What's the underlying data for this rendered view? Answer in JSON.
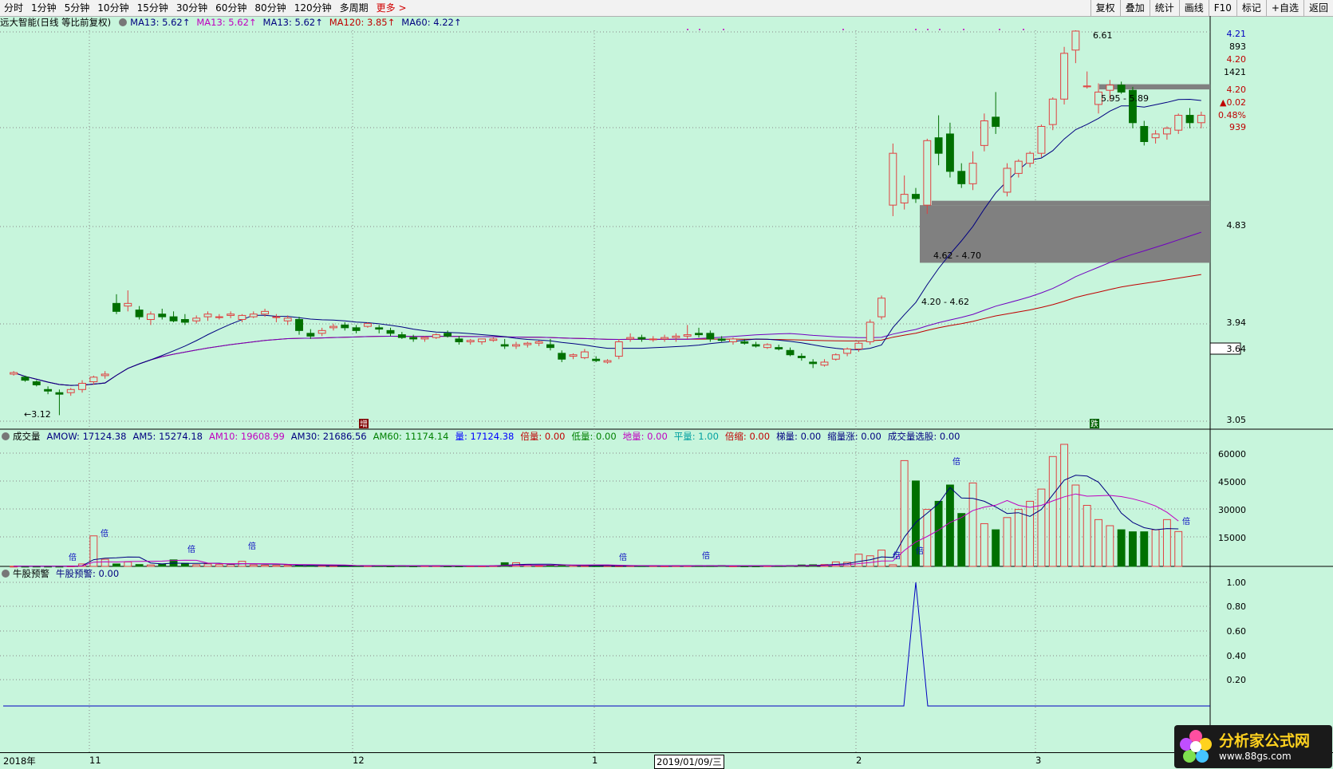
{
  "toolbar": {
    "left_items": [
      "分时",
      "1分钟",
      "5分钟",
      "10分钟",
      "15分钟",
      "30分钟",
      "60分钟",
      "80分钟",
      "120分钟",
      "多周期",
      "更多 >"
    ],
    "right_items": [
      "复权",
      "叠加",
      "统计",
      "画线",
      "F10",
      "标记",
      "+自选",
      "返回"
    ]
  },
  "price_header": {
    "title": "远大智能(日线 等比前复权)",
    "items": [
      {
        "text": "MA13: 5.62",
        "color": "#000080"
      },
      {
        "text": "MA13: 5.62",
        "color": "#c000c0"
      },
      {
        "text": "MA13: 5.62",
        "color": "#000080"
      },
      {
        "text": "MA120: 3.85",
        "color": "#c00000"
      },
      {
        "text": "MA60: 4.22",
        "color": "#000080"
      }
    ]
  },
  "volume_header": {
    "title": "成交量",
    "items": [
      {
        "text": "AMOW: 17124.38",
        "color": "#000080"
      },
      {
        "text": "AM5: 15274.18",
        "color": "#000080"
      },
      {
        "text": "AM10: 19608.99",
        "color": "#c000c0"
      },
      {
        "text": "AM30: 21686.56",
        "color": "#000080"
      },
      {
        "text": "AM60: 11174.14",
        "color": "#008000"
      },
      {
        "text": "量: 17124.38",
        "color": "#0000ff"
      },
      {
        "text": "倍量: 0.00",
        "color": "#c00000"
      },
      {
        "text": "低量: 0.00",
        "color": "#008000"
      },
      {
        "text": "地量: 0.00",
        "color": "#c000c0"
      },
      {
        "text": "平量: 1.00",
        "color": "#00a0a0"
      },
      {
        "text": "倍缩: 0.00",
        "color": "#c00000"
      },
      {
        "text": "梯量: 0.00",
        "color": "#000080"
      },
      {
        "text": "缩量涨: 0.00",
        "color": "#000080"
      },
      {
        "text": "成交量选股: 0.00",
        "color": "#000080"
      }
    ]
  },
  "bull_header": {
    "title": "牛股预警",
    "items": [
      {
        "text": "牛股预警: 0.00",
        "color": "#000080"
      }
    ]
  },
  "price_axis": [
    "4.21",
    "893",
    "4.20",
    "1421",
    "4.20",
    "▲0.02",
    "0.48%",
    "939",
    "4.83",
    "3.94",
    "3.64",
    "3.05"
  ],
  "volume_axis": [
    "60000",
    "45000",
    "30000",
    "15000"
  ],
  "bull_axis": [
    "1.00",
    "0.80",
    "0.60",
    "0.40",
    "0.20"
  ],
  "annotations": {
    "high": "6.61",
    "low": "3.12",
    "zone1": "5.95 - 5.89",
    "zone2": "4.62 - 4.70",
    "zone3": "4.20 - 4.62",
    "mark1": "增",
    "mark2": "跌",
    "vol_tag": "倍"
  },
  "date_axis": {
    "labels": [
      "2018年",
      "11",
      "12",
      "1",
      "2019/01/09/三",
      "2",
      "3"
    ]
  },
  "logo": {
    "title": "分析家公式网",
    "url": "www.88gs.com"
  },
  "chart_data": {
    "type": "candlestick",
    "title": "远大智能(日线 等比前复权)",
    "ohlc": [
      [
        3.38,
        3.4,
        3.37,
        3.39
      ],
      [
        3.36,
        3.37,
        3.33,
        3.34
      ],
      [
        3.33,
        3.34,
        3.3,
        3.31
      ],
      [
        3.28,
        3.3,
        3.25,
        3.27
      ],
      [
        3.26,
        3.28,
        3.12,
        3.25
      ],
      [
        3.26,
        3.29,
        3.24,
        3.28
      ],
      [
        3.28,
        3.34,
        3.26,
        3.32
      ],
      [
        3.33,
        3.37,
        3.31,
        3.36
      ],
      [
        3.37,
        3.4,
        3.35,
        3.38
      ],
      [
        3.88,
        3.95,
        3.8,
        3.82
      ],
      [
        3.86,
        3.98,
        3.82,
        3.88
      ],
      [
        3.83,
        3.86,
        3.76,
        3.78
      ],
      [
        3.76,
        3.82,
        3.72,
        3.8
      ],
      [
        3.8,
        3.84,
        3.76,
        3.78
      ],
      [
        3.78,
        3.82,
        3.74,
        3.75
      ],
      [
        3.76,
        3.8,
        3.72,
        3.74
      ],
      [
        3.75,
        3.79,
        3.73,
        3.77
      ],
      [
        3.78,
        3.82,
        3.75,
        3.8
      ],
      [
        3.78,
        3.8,
        3.76,
        3.78
      ],
      [
        3.79,
        3.82,
        3.77,
        3.8
      ],
      [
        3.76,
        3.8,
        3.74,
        3.79
      ],
      [
        3.78,
        3.82,
        3.77,
        3.8
      ],
      [
        3.8,
        3.84,
        3.78,
        3.82
      ],
      [
        3.78,
        3.8,
        3.74,
        3.78
      ],
      [
        3.75,
        3.79,
        3.72,
        3.77
      ],
      [
        3.76,
        3.78,
        3.65,
        3.68
      ],
      [
        3.66,
        3.69,
        3.62,
        3.64
      ],
      [
        3.66,
        3.7,
        3.64,
        3.68
      ],
      [
        3.7,
        3.73,
        3.68,
        3.71
      ],
      [
        3.72,
        3.74,
        3.68,
        3.7
      ],
      [
        3.7,
        3.72,
        3.66,
        3.68
      ],
      [
        3.71,
        3.74,
        3.7,
        3.73
      ],
      [
        3.7,
        3.72,
        3.66,
        3.69
      ],
      [
        3.68,
        3.7,
        3.64,
        3.66
      ],
      [
        3.65,
        3.67,
        3.62,
        3.63
      ],
      [
        3.63,
        3.65,
        3.6,
        3.62
      ],
      [
        3.62,
        3.64,
        3.6,
        3.63
      ],
      [
        3.63,
        3.66,
        3.62,
        3.65
      ],
      [
        3.66,
        3.68,
        3.63,
        3.64
      ],
      [
        3.62,
        3.64,
        3.58,
        3.6
      ],
      [
        3.6,
        3.62,
        3.58,
        3.61
      ],
      [
        3.6,
        3.62,
        3.58,
        3.62
      ],
      [
        3.61,
        3.63,
        3.6,
        3.62
      ],
      [
        3.58,
        3.62,
        3.55,
        3.57
      ],
      [
        3.57,
        3.6,
        3.55,
        3.58
      ],
      [
        3.58,
        3.6,
        3.56,
        3.59
      ],
      [
        3.59,
        3.61,
        3.57,
        3.6
      ],
      [
        3.58,
        3.62,
        3.54,
        3.56
      ],
      [
        3.52,
        3.54,
        3.46,
        3.48
      ],
      [
        3.5,
        3.52,
        3.48,
        3.51
      ],
      [
        3.49,
        3.55,
        3.48,
        3.53
      ],
      [
        3.48,
        3.5,
        3.46,
        3.47
      ],
      [
        3.46,
        3.48,
        3.45,
        3.47
      ],
      [
        3.5,
        3.62,
        3.48,
        3.6
      ],
      [
        3.62,
        3.66,
        3.6,
        3.63
      ],
      [
        3.63,
        3.65,
        3.6,
        3.62
      ],
      [
        3.62,
        3.64,
        3.6,
        3.62
      ],
      [
        3.62,
        3.65,
        3.6,
        3.63
      ],
      [
        3.63,
        3.66,
        3.6,
        3.64
      ],
      [
        3.64,
        3.72,
        3.62,
        3.65
      ],
      [
        3.66,
        3.7,
        3.63,
        3.65
      ],
      [
        3.66,
        3.68,
        3.6,
        3.62
      ],
      [
        3.62,
        3.64,
        3.6,
        3.61
      ],
      [
        3.6,
        3.63,
        3.58,
        3.62
      ],
      [
        3.6,
        3.62,
        3.58,
        3.59
      ],
      [
        3.58,
        3.6,
        3.56,
        3.57
      ],
      [
        3.56,
        3.59,
        3.55,
        3.58
      ],
      [
        3.56,
        3.58,
        3.54,
        3.55
      ],
      [
        3.54,
        3.56,
        3.5,
        3.51
      ],
      [
        3.5,
        3.52,
        3.47,
        3.49
      ],
      [
        3.46,
        3.48,
        3.42,
        3.45
      ],
      [
        3.44,
        3.48,
        3.43,
        3.46
      ],
      [
        3.48,
        3.52,
        3.47,
        3.51
      ],
      [
        3.52,
        3.56,
        3.5,
        3.55
      ],
      [
        3.55,
        3.6,
        3.53,
        3.59
      ],
      [
        3.6,
        3.76,
        3.58,
        3.74
      ],
      [
        3.78,
        3.94,
        3.76,
        3.92
      ],
      [
        4.7,
        5.3,
        4.6,
        5.2
      ],
      [
        4.72,
        4.98,
        4.66,
        4.8
      ],
      [
        4.8,
        4.86,
        4.72,
        4.76
      ],
      [
        4.7,
        5.35,
        4.62,
        5.33
      ],
      [
        5.36,
        5.6,
        5.08,
        5.2
      ],
      [
        5.4,
        5.52,
        4.96,
        5.02
      ],
      [
        5.02,
        5.1,
        4.86,
        4.9
      ],
      [
        4.9,
        5.22,
        4.84,
        5.1
      ],
      [
        5.28,
        5.62,
        5.22,
        5.54
      ],
      [
        5.58,
        5.86,
        5.4,
        5.48
      ],
      [
        4.82,
        5.1,
        4.78,
        5.05
      ],
      [
        5.0,
        5.14,
        4.96,
        5.12
      ],
      [
        5.1,
        5.22,
        5.06,
        5.2
      ],
      [
        5.2,
        5.5,
        5.16,
        5.48
      ],
      [
        5.5,
        5.8,
        5.44,
        5.78
      ],
      [
        5.78,
        6.4,
        5.72,
        6.32
      ],
      [
        6.36,
        6.61,
        6.2,
        6.6
      ],
      [
        5.92,
        6.1,
        5.9,
        5.93
      ],
      [
        5.72,
        5.96,
        5.62,
        5.86
      ],
      [
        5.88,
        6.0,
        5.76,
        5.94
      ],
      [
        5.94,
        5.98,
        5.84,
        5.86
      ],
      [
        5.88,
        5.92,
        5.46,
        5.52
      ],
      [
        5.48,
        5.54,
        5.28,
        5.32
      ],
      [
        5.36,
        5.44,
        5.3,
        5.4
      ],
      [
        5.4,
        5.48,
        5.34,
        5.46
      ],
      [
        5.44,
        5.62,
        5.4,
        5.6
      ],
      [
        5.6,
        5.68,
        5.46,
        5.52
      ],
      [
        5.52,
        5.64,
        5.46,
        5.6
      ]
    ],
    "ma_lines": [
      {
        "name": "MA13",
        "color": "#000080"
      },
      {
        "name": "MA60",
        "color": "#7000c0"
      },
      {
        "name": "MA120",
        "color": "#c00000"
      }
    ],
    "volume": [
      80,
      60,
      90,
      70,
      60,
      200,
      1200,
      15000,
      3500,
      1200,
      2200,
      900,
      700,
      1000,
      3200,
      1500,
      800,
      1200,
      900,
      900,
      2500,
      700,
      600,
      500,
      500,
      500,
      400,
      400,
      300,
      300,
      300,
      300,
      300,
      200,
      300,
      200,
      300,
      300,
      200,
      200,
      200,
      200,
      300,
      1800,
      1800,
      1000,
      300,
      400,
      600,
      500,
      300,
      300,
      300,
      200,
      300,
      300,
      300,
      200,
      300,
      300,
      300,
      300,
      400,
      200,
      200,
      200,
      300,
      300,
      400,
      700,
      800,
      900,
      2200,
      2000,
      6000,
      5200,
      8000,
      800,
      52000,
      42000,
      28000,
      32000,
      40000,
      26000,
      41000,
      21000,
      18000,
      24000,
      28000,
      32000,
      38000,
      54000,
      60000,
      40000,
      30000,
      23000,
      20000,
      18000,
      17000,
      17000,
      18000,
      23000,
      17124
    ],
    "bull_signal_peak": 1.0,
    "bull_axis_range": [
      0,
      1.0
    ],
    "volume_axis_range": [
      0,
      60000
    ],
    "price_axis_range": [
      3.05,
      6.61
    ]
  }
}
